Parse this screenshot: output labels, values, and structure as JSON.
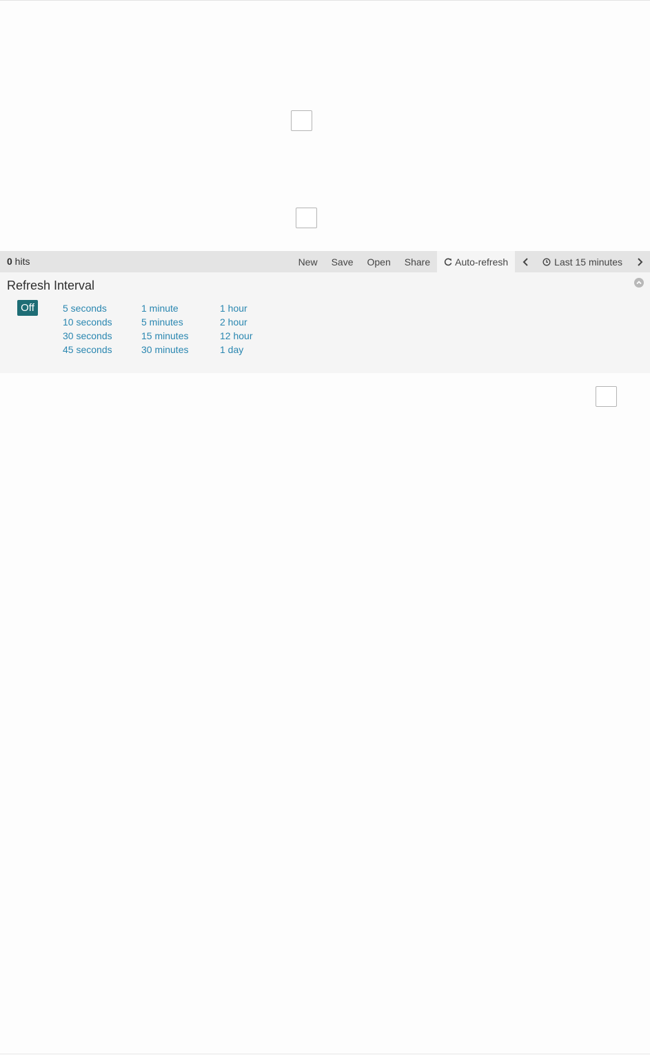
{
  "navbar": {
    "hits_count": "0",
    "hits_label": " hits",
    "links": {
      "new": "New",
      "save": "Save",
      "open": "Open",
      "share": "Share",
      "auto_refresh": "Auto-refresh",
      "time_range": "Last 15 minutes"
    },
    "icons": {
      "auto_refresh": "refresh-icon",
      "time_range": "clock-icon",
      "prev": "chevron-left-icon",
      "next": "chevron-right-icon"
    }
  },
  "refresh_panel": {
    "title": "Refresh Interval",
    "selected": "Off",
    "off_label": "Off",
    "columns": [
      [
        "5 seconds",
        "10 seconds",
        "30 seconds",
        "45 seconds"
      ],
      [
        "1 minute",
        "5 minutes",
        "15 minutes",
        "30 minutes"
      ],
      [
        "1 hour",
        "2 hour",
        "12 hour",
        "1 day"
      ]
    ],
    "collapse_icon": "chevron-up-circle-icon"
  },
  "colors": {
    "accent": "#1e6d75",
    "link": "#2986b0",
    "navbar_bg": "#e4e4e4",
    "panel_bg": "#f5f5f5"
  }
}
